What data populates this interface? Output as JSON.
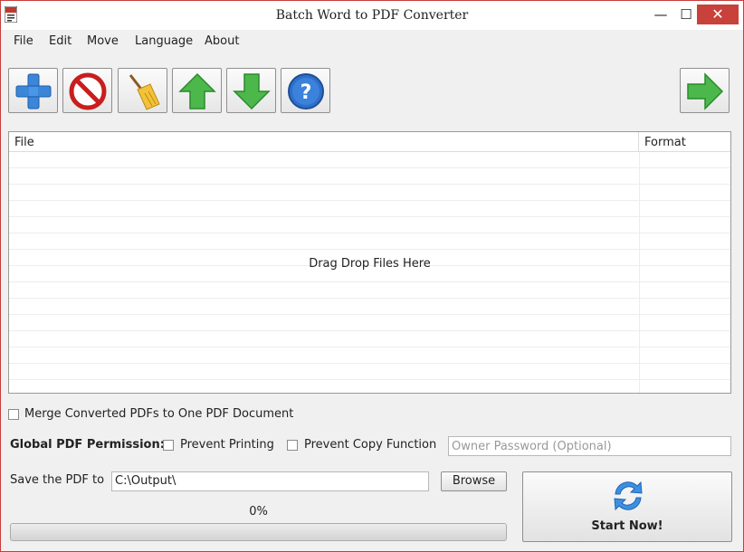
{
  "window": {
    "title": "Batch Word to PDF Converter",
    "minimize": "—",
    "maximize": "☐",
    "close": "✕"
  },
  "menu": [
    "File",
    "Edit",
    "Move",
    "Language",
    "About"
  ],
  "toolbar": {
    "add_icon": "plus-icon",
    "remove_icon": "no-entry-icon",
    "clear_icon": "broom-icon",
    "up_icon": "arrow-up-icon",
    "down_icon": "arrow-down-icon",
    "help_icon": "help-icon",
    "next_icon": "arrow-right-icon"
  },
  "file_table": {
    "columns": [
      "File",
      "Format"
    ],
    "rows": [],
    "drop_hint": "Drag  Drop Files Here"
  },
  "options": {
    "merge_label": "Merge Converted PDFs to One PDF Document",
    "merge_checked": false,
    "permission_label": "Global PDF Permission:",
    "prevent_printing_label": "Prevent Printing",
    "prevent_printing_checked": false,
    "prevent_copy_label": "Prevent Copy Function",
    "prevent_copy_checked": false,
    "owner_password_placeholder": "Owner Password (Optional)",
    "owner_password_value": ""
  },
  "output": {
    "save_label": "Save the PDF to",
    "path": "C:\\Output\\",
    "browse_label": "Browse"
  },
  "progress": {
    "percent_text": "0%",
    "value": 0
  },
  "start": {
    "label": "Start Now!",
    "icon": "refresh-icon"
  },
  "colors": {
    "close_button": "#c8413a",
    "window_border": "#c83c3c",
    "accent_green": "#3aa03a",
    "accent_blue": "#2f7fd6"
  }
}
